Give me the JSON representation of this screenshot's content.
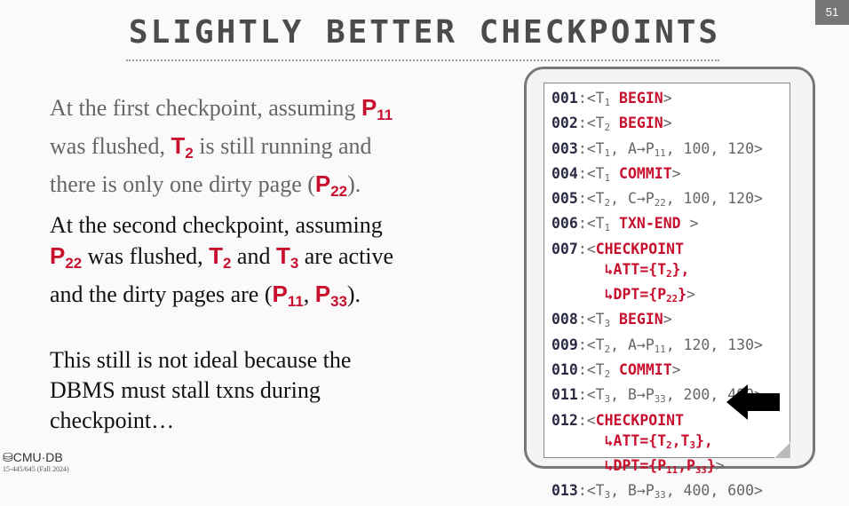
{
  "title": "SLIGHTLY BETTER CHECKPOINTS",
  "page_number": "51",
  "footer": {
    "logo": "CMU·DB",
    "course": "15-445/645 (Fall 2024)"
  },
  "paragraphs": [
    [
      [
        "At the first checkpoint, assuming ",
        ""
      ],
      [
        "P",
        "hl",
        "11"
      ],
      [
        "\nwas flushed, ",
        ""
      ],
      [
        "T",
        "hl",
        "2"
      ],
      [
        " is still running and\nthere is only one dirty page (",
        ""
      ],
      [
        "P",
        "hl",
        "22"
      ],
      [
        ").",
        ""
      ]
    ],
    [
      [
        "At the second checkpoint, assuming\n",
        ""
      ],
      [
        "P",
        "hl",
        "22"
      ],
      [
        "  was flushed, ",
        ""
      ],
      [
        "T",
        "hl",
        "2"
      ],
      [
        " and ",
        ""
      ],
      [
        "T",
        "hl",
        "3"
      ],
      [
        " are active\nand the dirty pages are (",
        ""
      ],
      [
        "P",
        "hl",
        "11"
      ],
      [
        ",  ",
        ""
      ],
      [
        "P",
        "hl",
        "33"
      ],
      [
        ").",
        ""
      ]
    ],
    [
      [
        "This still is not ideal because the\nDBMS must stall txns during\ncheckpoint…",
        ""
      ]
    ]
  ],
  "log": [
    [
      [
        "001",
        "num"
      ],
      [
        ":<T",
        "g",
        "1"
      ],
      [
        " BEGIN",
        "r"
      ],
      [
        ">",
        "g"
      ]
    ],
    [
      [
        "002",
        "num"
      ],
      [
        ":<T",
        "g",
        "2"
      ],
      [
        " BEGIN",
        "r"
      ],
      [
        ">",
        "g"
      ]
    ],
    [
      [
        "003",
        "num"
      ],
      [
        ":<T",
        "g",
        "1"
      ],
      [
        ", A→P",
        "g",
        "11"
      ],
      [
        ", 100, 120>",
        "g"
      ]
    ],
    [
      [
        "004",
        "num"
      ],
      [
        ":<T",
        "g",
        "1"
      ],
      [
        " COMMIT",
        "r"
      ],
      [
        ">",
        "g"
      ]
    ],
    [
      [
        "005",
        "num"
      ],
      [
        ":<T",
        "g",
        "2"
      ],
      [
        ", C→P",
        "g",
        "22"
      ],
      [
        ", 100, 120>",
        "g"
      ]
    ],
    [
      [
        "006",
        "num"
      ],
      [
        ":<T",
        "g",
        "1"
      ],
      [
        " TXN-END",
        "r"
      ],
      [
        " >",
        "g"
      ]
    ],
    [
      [
        "007",
        "num"
      ],
      [
        ":<",
        "g"
      ],
      [
        "CHECKPOINT",
        "r"
      ]
    ],
    [
      [
        "      ↳ATT={T",
        "r",
        "2"
      ],
      [
        "},",
        "r"
      ]
    ],
    [
      [
        "      ↳DPT={P",
        "r",
        "22"
      ],
      [
        "}",
        "r"
      ],
      [
        ">",
        "g"
      ]
    ],
    [
      [
        "008",
        "num"
      ],
      [
        ":<T",
        "g",
        "3"
      ],
      [
        " BEGIN",
        "r"
      ],
      [
        ">",
        "g"
      ]
    ],
    [
      [
        "009",
        "num"
      ],
      [
        ":<T",
        "g",
        "2"
      ],
      [
        ", A→P",
        "g",
        "11"
      ],
      [
        ", 120, 130>",
        "g"
      ]
    ],
    [
      [
        "010",
        "num"
      ],
      [
        ":<T",
        "g",
        "2"
      ],
      [
        " COMMIT",
        "r"
      ],
      [
        ">",
        "g"
      ]
    ],
    [
      [
        "011",
        "num"
      ],
      [
        ":<T",
        "g",
        "3"
      ],
      [
        ", B→P",
        "g",
        "33"
      ],
      [
        ", 200, 400>",
        "g"
      ]
    ],
    [
      [
        "012",
        "num"
      ],
      [
        ":<",
        "g"
      ],
      [
        "CHECKPOINT",
        "r"
      ]
    ],
    [
      [
        "      ↳ATT={T",
        "r",
        "2"
      ],
      [
        ",T",
        "r",
        "3"
      ],
      [
        "},",
        "r"
      ]
    ],
    [
      [
        "      ↳DPT={P",
        "r",
        "11"
      ],
      [
        ",P",
        "r",
        "33"
      ],
      [
        "}",
        "r"
      ],
      [
        ">",
        "g"
      ]
    ],
    [
      [
        "013",
        "num"
      ],
      [
        ":<T",
        "g",
        "3"
      ],
      [
        ", B→P",
        "g",
        "33"
      ],
      [
        ", 400, 600>",
        "g"
      ]
    ]
  ],
  "colors": {
    "accent": "#c8102e",
    "title": "#4b4b4b"
  },
  "icons": {
    "arrow": "left-arrow-icon",
    "logo": "database-icon"
  }
}
